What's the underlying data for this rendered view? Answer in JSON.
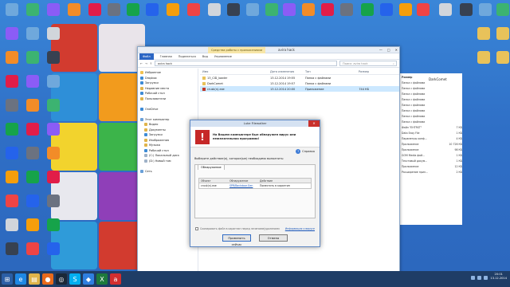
{
  "explorer": {
    "title": "avira hack",
    "context_tab": "Средства работы с приложениями",
    "tabs": [
      "Файл",
      "Главная",
      "Поделиться",
      "Вид",
      "Управление"
    ],
    "address": "avira hack",
    "search_placeholder": "Поиск: avira hack",
    "nav": [
      {
        "label": "Избранное",
        "color": "#f2c14e"
      },
      {
        "label": "Dropbox",
        "color": "#3d8bd6"
      },
      {
        "label": "Загрузки",
        "color": "#3d8bd6"
      },
      {
        "label": "Недавние места",
        "color": "#e0b44a"
      },
      {
        "label": "Рабочий стол",
        "color": "#3d8bd6"
      },
      {
        "label": "Пользователи",
        "color": "#e0b44a"
      },
      {
        "label": "",
        "color": "transparent"
      },
      {
        "label": "OneDrive",
        "color": "#3d8bd6"
      },
      {
        "label": "",
        "color": "transparent"
      },
      {
        "label": "Этот компьютер",
        "color": "#6aa0d8"
      },
      {
        "label": "Видео",
        "color": "#e0b44a"
      },
      {
        "label": "Документы",
        "color": "#e0b44a"
      },
      {
        "label": "Загрузки",
        "color": "#3d8bd6"
      },
      {
        "label": "Изображения",
        "color": "#e0b44a"
      },
      {
        "label": "Музыка",
        "color": "#e0b44a"
      },
      {
        "label": "Рабочий стол",
        "color": "#3d8bd6"
      },
      {
        "label": "(C:) Локальный диск",
        "color": "#9fb2c8"
      },
      {
        "label": "(D:) Новый том",
        "color": "#9fb2c8"
      },
      {
        "label": "",
        "color": "transparent"
      },
      {
        "label": "Сеть",
        "color": "#6aa0d8"
      }
    ],
    "columns": {
      "name": "Имя",
      "date": "Дата изменения",
      "type": "Тип",
      "size": "Размер"
    },
    "rows": [
      {
        "name": "13_CID_loader",
        "date": "13.12.2014 19:55",
        "type": "Папка с файлами",
        "size": "",
        "icon_color": "#e8c25a",
        "selected": false
      },
      {
        "name": "DarkComet",
        "date": "13.12.2014 19:57",
        "type": "Папка с файлами",
        "size": "",
        "icon_color": "#e8c25a",
        "selected": false
      },
      {
        "name": "crusk(n).exe",
        "date": "13.12.2014 20:00",
        "type": "Приложение",
        "size": "744 КБ",
        "icon_color": "#c0392b",
        "selected": true
      }
    ]
  },
  "dialog": {
    "title": "Luke Filewalker",
    "close": "✕",
    "question": "На Вашем компьютере был обнаружен вирус или нежелательная программа!",
    "help": "Справка",
    "instruction": "Выберите действие(я), которое(ые) необходимо выполнить:",
    "group_tab": "Обнаружение",
    "table_headers": [
      "Объект",
      "Обнаружение",
      "Действие"
    ],
    "table_rows": [
      {
        "object": "crusk(n).exe",
        "detection": "SPR/Backdoor.Gen",
        "action": "Поместить в карантин"
      }
    ],
    "checkbox_label": "Скопировать файл в карантин перед лечением/удалением",
    "more_link": "Информация о вирусе",
    "apply_button": "Применить сейчас",
    "cancel_button": "Отмена"
  },
  "right_window": {
    "title": "DarkComet",
    "size_header": "Размер",
    "rows": [
      "Папка с файлами",
      "Папка с файлами",
      "Папка с файлами",
      "Папка с файлами",
      "Папка с файлами",
      "Папка с файлами",
      "Папка с файлами",
      "Папка с файлами",
      "Файл \"EHTRST\"",
      "Data Easy File",
      "Параметры конф...",
      "Приложение",
      "Приложение",
      "GOM Media фай...",
      "Текстовый докум...",
      "Приложение",
      "Расширение прил..."
    ],
    "sizes": [
      "",
      "",
      "",
      "",
      "",
      "",
      "",
      "",
      "7 КБ",
      "1 КБ",
      "4 КБ",
      "10 726 КБ",
      "98 КБ",
      "1 КБ",
      "1 КБ",
      "12 КБ",
      "2 КБ"
    ]
  },
  "desktop_icons": [
    {
      "label": "",
      "color": "#6fa8dc"
    },
    {
      "label": "",
      "color": "#3cb371"
    },
    {
      "label": "",
      "color": "#8b5cf6"
    },
    {
      "label": "",
      "color": "#f28c28"
    },
    {
      "label": "",
      "color": "#e11d48"
    },
    {
      "label": "",
      "color": "#6b7280"
    },
    {
      "label": "",
      "color": "#16a34a"
    },
    {
      "label": "",
      "color": "#2563eb"
    },
    {
      "label": "",
      "color": "#f59e0b"
    },
    {
      "label": "",
      "color": "#ef4444"
    },
    {
      "label": "",
      "color": "#d1d5db"
    },
    {
      "label": "",
      "color": "#374151"
    }
  ],
  "taskbar": {
    "items": [
      {
        "name": "start",
        "glyph": "⊞",
        "color": "#2b5fa6"
      },
      {
        "name": "ie",
        "glyph": "e",
        "color": "#1e88e5"
      },
      {
        "name": "explorer",
        "glyph": "▤",
        "color": "#e0b44a"
      },
      {
        "name": "firefox",
        "glyph": "●",
        "color": "#e86a1c"
      },
      {
        "name": "steam",
        "glyph": "◎",
        "color": "#1b2838"
      },
      {
        "name": "skype",
        "glyph": "S",
        "color": "#00aff0"
      },
      {
        "name": "dropbox",
        "glyph": "◆",
        "color": "#2f7fe0"
      },
      {
        "name": "excel",
        "glyph": "X",
        "color": "#1e7a3c"
      },
      {
        "name": "avira",
        "glyph": "a",
        "color": "#d32f2f"
      }
    ],
    "time": "20:01",
    "date": "13.12.2014"
  }
}
